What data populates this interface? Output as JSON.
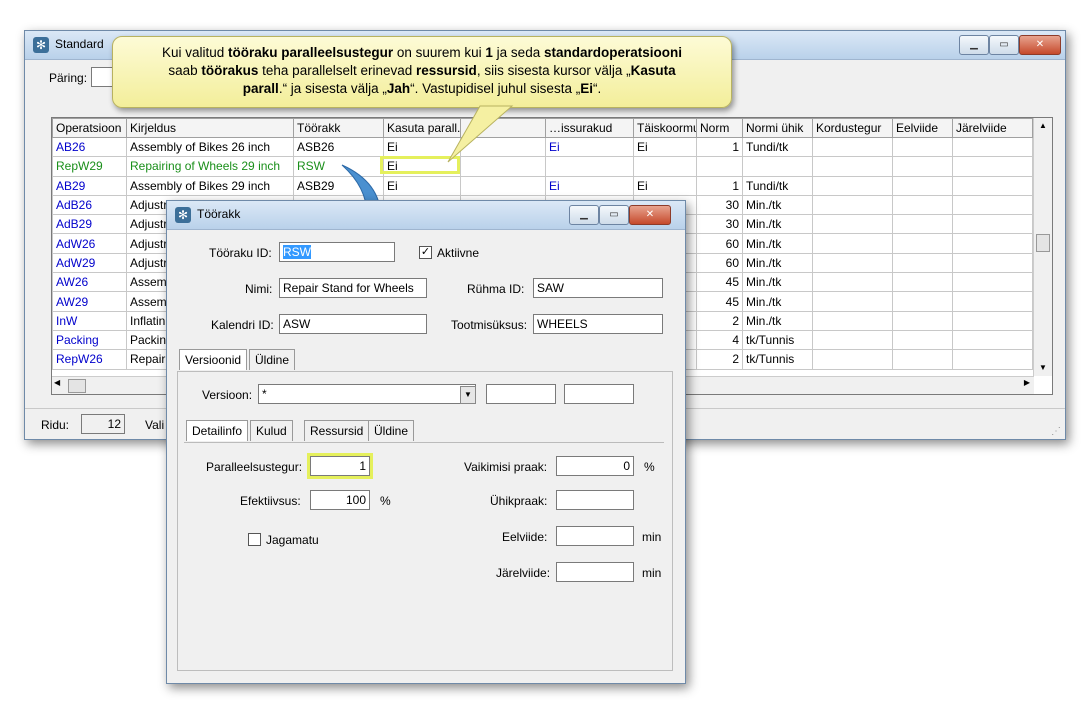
{
  "main_window": {
    "title": "Standard",
    "query_label": "Päring:",
    "columns": [
      "Operatsioon",
      "Kirjeldus",
      "Töörakk",
      "Kasuta parall.",
      "",
      "…issurakud",
      "Täiskoormu",
      "Norm",
      "Normi ühik",
      "Kordustegur",
      "Eelviide",
      "Järelviide"
    ],
    "rows": [
      {
        "op": "AB26",
        "desc": "Assembly of Bikes 26 inch",
        "rakk": "ASB26",
        "par": "Ei",
        "res": "Ei",
        "full": "Ei",
        "norm": "1",
        "unit": "Tundi/tk",
        "color": "blue"
      },
      {
        "op": "RepW29",
        "desc": "Repairing of Wheels 29 inch",
        "rakk": "RSW",
        "par": "Ei",
        "res": "",
        "full": "",
        "norm": "",
        "unit": "",
        "color": "green"
      },
      {
        "op": "AB29",
        "desc": "Assembly of Bikes 29 inch",
        "rakk": "ASB29",
        "par": "Ei",
        "res": "Ei",
        "full": "Ei",
        "norm": "1",
        "unit": "Tundi/tk",
        "color": "blue"
      },
      {
        "op": "AdB26",
        "desc": "Adjustr",
        "rakk": "",
        "par": "",
        "res": "",
        "full": "",
        "norm": "30",
        "unit": "Min./tk",
        "color": "blue"
      },
      {
        "op": "AdB29",
        "desc": "Adjustr",
        "rakk": "",
        "par": "",
        "res": "",
        "full": "",
        "norm": "30",
        "unit": "Min./tk",
        "color": "blue"
      },
      {
        "op": "AdW26",
        "desc": "Adjustr",
        "rakk": "",
        "par": "",
        "res": "",
        "full": "",
        "norm": "60",
        "unit": "Min./tk",
        "color": "blue"
      },
      {
        "op": "AdW29",
        "desc": "Adjustr",
        "rakk": "",
        "par": "",
        "res": "",
        "full": "",
        "norm": "60",
        "unit": "Min./tk",
        "color": "blue"
      },
      {
        "op": "AW26",
        "desc": "Assem",
        "rakk": "",
        "par": "",
        "res": "",
        "full": "",
        "norm": "45",
        "unit": "Min./tk",
        "color": "blue"
      },
      {
        "op": "AW29",
        "desc": "Assem",
        "rakk": "",
        "par": "",
        "res": "",
        "full": "",
        "norm": "45",
        "unit": "Min./tk",
        "color": "blue"
      },
      {
        "op": "InW",
        "desc": "Inflatin",
        "rakk": "",
        "par": "",
        "res": "",
        "full": "",
        "norm": "2",
        "unit": "Min./tk",
        "color": "blue"
      },
      {
        "op": "Packing",
        "desc": "Packin",
        "rakk": "",
        "par": "",
        "res": "",
        "full": "",
        "norm": "4",
        "unit": "tk/Tunnis",
        "color": "blue"
      },
      {
        "op": "RepW26",
        "desc": "Repair",
        "rakk": "",
        "par": "",
        "res": "",
        "full": "",
        "norm": "2",
        "unit": "tk/Tunnis",
        "color": "blue"
      }
    ],
    "row_count_label": "Ridu:",
    "row_count": "12",
    "status_text": "Vali"
  },
  "callout": {
    "line1_a": "Kui valitud ",
    "line1_b": "tööraku paralleelsustegur",
    "line1_c": " on suurem kui ",
    "line1_d": "1",
    "line1_e": " ja seda ",
    "line1_f": "standardoperatsiooni",
    "line2_a": "saab ",
    "line2_b": "töörakus",
    "line2_c": " teha parallelselt erinevad ",
    "line2_d": "ressursid",
    "line2_e": ", siis sisesta kursor välja „",
    "line2_f": "Kasuta",
    "line3_a": "parall",
    "line3_b": ".“ ja sisesta välja „",
    "line3_c": "Jah",
    "line3_d": "“.  Vastupidisel juhul sisesta „",
    "line3_e": "Ei",
    "line3_f": "“."
  },
  "dialog": {
    "title": "Töörakk",
    "id_label": "Tööraku ID:",
    "id_value": "RSW",
    "active_label": "Aktiivne",
    "name_label": "Nimi:",
    "name_value": "Repair Stand for Wheels",
    "group_label": "Rühma ID:",
    "group_value": "SAW",
    "calendar_label": "Kalendri ID:",
    "calendar_value": "ASW",
    "unit_label": "Tootmisüksus:",
    "unit_value": "WHEELS",
    "tabs_top": [
      "Versioonid",
      "Üldine"
    ],
    "version_label": "Versioon:",
    "version_value": "*",
    "tabs_inner": [
      "Detailinfo",
      "Kulud",
      "Ressursid",
      "Üldine"
    ],
    "parallel_label": "Paralleelsustegur:",
    "parallel_value": "1",
    "efficiency_label": "Efektiivsus:",
    "efficiency_value": "100",
    "percent": "%",
    "indivisible_label": "Jagamatu",
    "scrap_label": "Vaikimisi praak:",
    "scrap_value": "0",
    "unit_scrap_label": "Ühikpraak:",
    "pre_label": "Eelviide:",
    "post_label": "Järelviide:",
    "min": "min"
  }
}
